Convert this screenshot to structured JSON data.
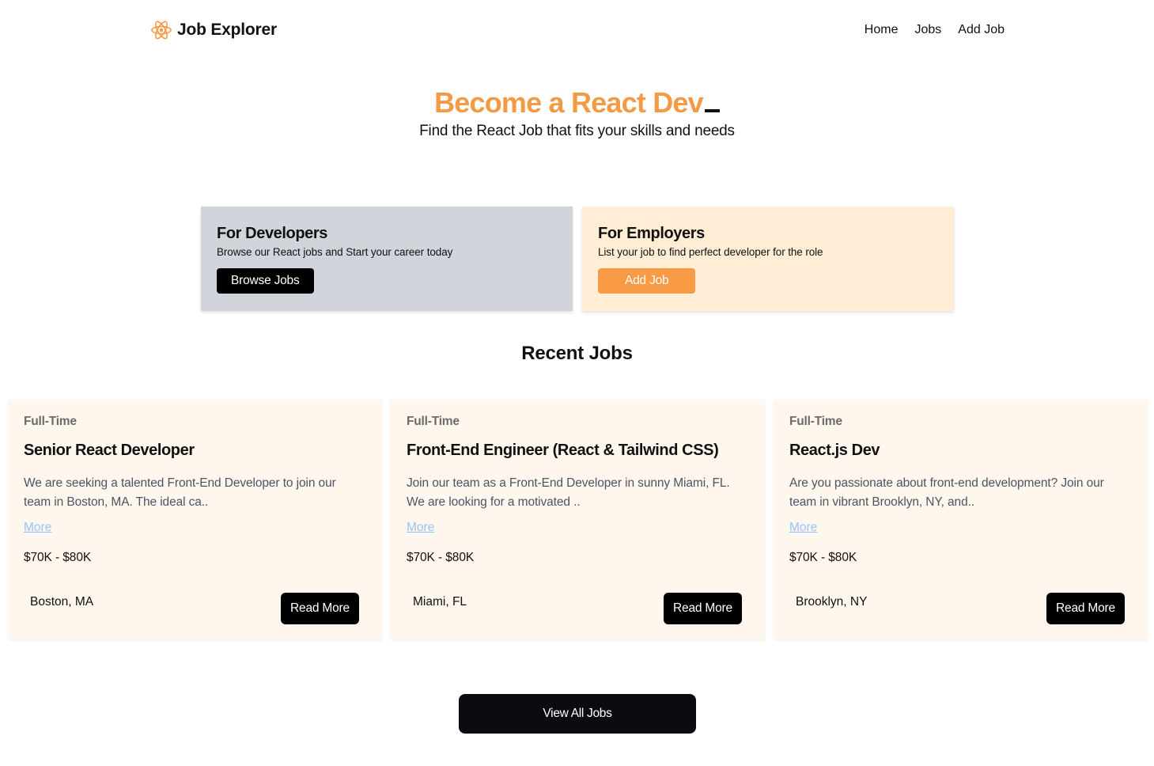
{
  "brand": {
    "name": "Job Explorer",
    "icon": "react-atom-icon",
    "accent": "#f59a44"
  },
  "nav": {
    "links": [
      {
        "label": "Home"
      },
      {
        "label": "Jobs"
      },
      {
        "label": "Add Job"
      }
    ]
  },
  "hero": {
    "title": "Become a React Dev",
    "subtitle": "Find the React Job that fits your skills and needs"
  },
  "boxes": {
    "developers": {
      "title": "For Developers",
      "text": "Browse our React jobs and Start your career today",
      "button": "Browse Jobs",
      "bg": "#d1d5db"
    },
    "employers": {
      "title": "For Employers",
      "text": "List your job to find perfect developer for the role",
      "button": "Add Job",
      "bg": "#ffedd5",
      "button_color": "#f99b45"
    }
  },
  "recent": {
    "title": "Recent Jobs",
    "jobs": [
      {
        "type": "Full-Time",
        "title": "Senior React Developer",
        "description": "We are seeking a talented Front-End Developer to join our team in Boston, MA. The ideal ca..",
        "more": "More",
        "salary": "$70K - $80K",
        "location": "Boston, MA",
        "button": "Read More"
      },
      {
        "type": "Full-Time",
        "title": "Front-End Engineer (React & Tailwind CSS)",
        "description": "Join our team as a Front-End Developer in sunny Miami, FL. We are looking for a motivated ..",
        "more": "More",
        "salary": "$70K - $80K",
        "location": "Miami, FL",
        "button": "Read More"
      },
      {
        "type": "Full-Time",
        "title": "React.js Dev",
        "description": "Are you passionate about front-end development? Join our team in vibrant Brooklyn, NY, and..",
        "more": "More",
        "salary": "$70K - $80K",
        "location": "Brooklyn, NY",
        "button": "Read More"
      }
    ],
    "view_all": "View All Jobs"
  }
}
